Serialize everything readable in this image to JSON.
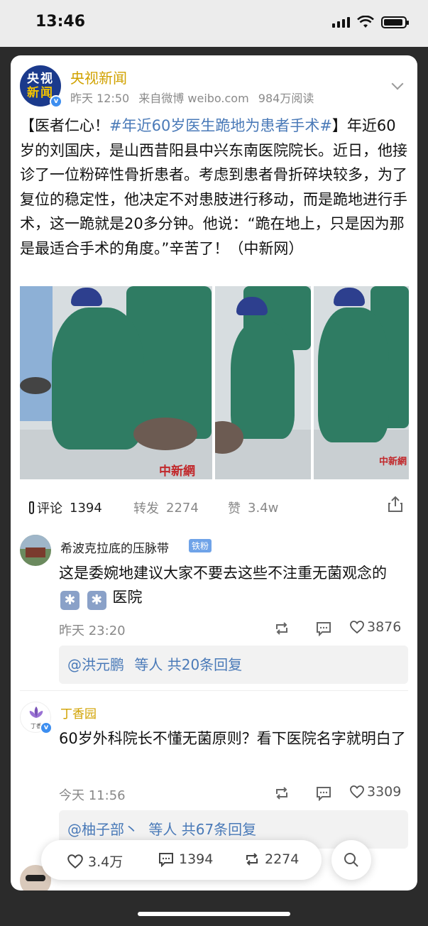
{
  "status": {
    "time": "13:46"
  },
  "post": {
    "author": "央视新闻",
    "avatar_text_line1": "央视",
    "avatar_text_line2": "新闻",
    "time": "昨天 12:50",
    "source": "来自微博 weibo.com",
    "reads": "984万阅读",
    "body_prefix": "【医者仁心！",
    "hashtag": "#年近60岁医生跪地为患者手术#",
    "body_suffix": "】年近60岁的刘国庆，是山西昔阳县中兴东南医院院长。近日，他接诊了一位粉碎性骨折患者。考虑到患者骨折碎块较多，为了复位的稳定性，他决定不对患肢进行移动，而是跪地进行手术，这一跪就是20多分钟。他说：“跪在地上，只是因为那是最适合手术的角度。”辛苦了！（中新网）",
    "watermark": "中新網"
  },
  "actions": {
    "comment_label": "评论",
    "comment_count": "1394",
    "repost_label": "转发",
    "repost_count": "2274",
    "like_label": "赞",
    "like_count": "3.4w"
  },
  "comments": [
    {
      "user": "希波克拉底的压脉带",
      "badge": "铁粉",
      "text_before": "这是委婉地建议大家不要去这些不注重无菌观念的",
      "emoji": "✱",
      "text_after": "医院",
      "time": "昨天 23:20",
      "likes": "3876",
      "reply_user": "@洪元鹏",
      "reply_summary": "等人  共20条回复"
    },
    {
      "user": "丁香园",
      "avatar_text": "丁香",
      "text": "60岁外科院长不懂无菌原则？看下医院名字就明白了",
      "time": "今天 11:56",
      "likes": "3309",
      "reply_user": "@柚子部丶",
      "reply_summary": "等人  共67条回复"
    }
  ],
  "floating_bar": {
    "likes": "3.4万",
    "comments": "1394",
    "reposts": "2274"
  },
  "icons": [
    "signal-icon",
    "wifi-icon",
    "battery-icon",
    "chevron-down-icon",
    "thermometer-icon",
    "share-icon",
    "repost-icon",
    "comment-icon",
    "heart-icon",
    "search-icon",
    "verified-icon"
  ],
  "colors": {
    "author": "#d1a200",
    "link": "#4a7ab8",
    "verified": "#3d8ef0"
  }
}
